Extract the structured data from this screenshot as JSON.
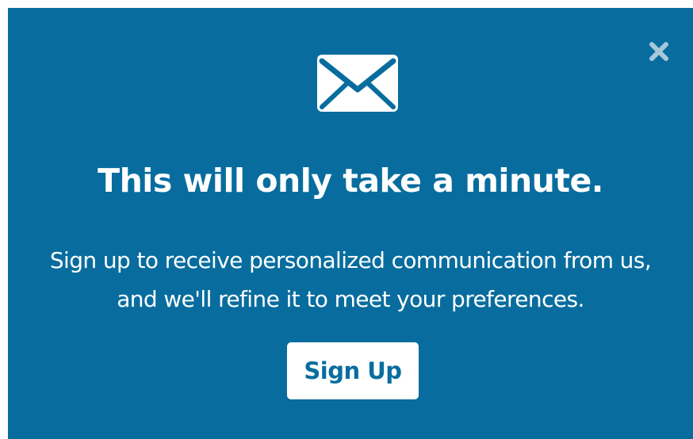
{
  "modal": {
    "close_icon": "close-x-icon",
    "envelope_icon": "envelope-icon",
    "title": "This will only take a minute.",
    "description": "Sign up to receive personalized communication from us, and we'll refine it to meet your preferences.",
    "signup_label": "Sign Up"
  },
  "colors": {
    "background": "#086d9e",
    "text": "#ffffff",
    "button_text": "#086d9e",
    "close_icon": "#a9c7da"
  }
}
